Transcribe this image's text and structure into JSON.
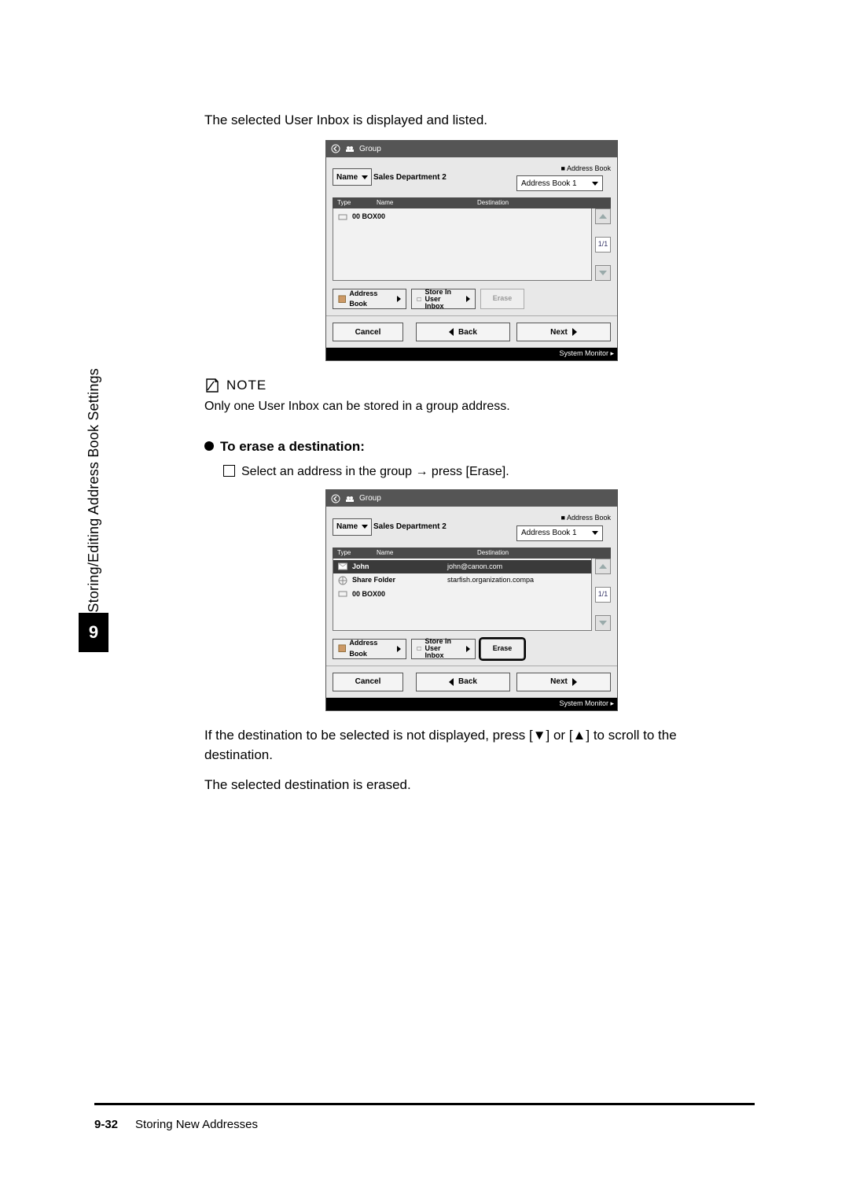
{
  "sidebar": {
    "chapter_title": "Storing/Editing Address Book Settings",
    "chapter_number": "9"
  },
  "section": {
    "intro_line": "The selected User Inbox is displayed and listed.",
    "note_label": "NOTE",
    "note_body": "Only one User Inbox can be stored in a group address.",
    "bullet_heading": "To erase a destination:",
    "step_prefix": "Select an address in the group ",
    "step_suffix": " press [Erase].",
    "after_shot_1a": "If the destination to be selected is not displayed, press [",
    "after_shot_1b": "] or [",
    "after_shot_1c": "] to scroll to the destination.",
    "after_shot_2": "The selected destination is erased."
  },
  "shot_a": {
    "title": "Group",
    "name_button": "Name",
    "name_value": "Sales Department 2",
    "addr_label": "■ Address Book",
    "addr_value": "Address Book 1",
    "col_type": "Type",
    "col_name": "Name",
    "col_dest": "Destination",
    "rows": [
      {
        "name": "00 BOX00",
        "dest": ""
      }
    ],
    "page": "1/1",
    "toolbar": {
      "address_book": "Address Book",
      "store_in": "Store In User Inbox",
      "erase": "Erase"
    },
    "nav": {
      "cancel": "Cancel",
      "back": "Back",
      "next": "Next"
    },
    "status": "System Monitor"
  },
  "shot_b": {
    "title": "Group",
    "name_button": "Name",
    "name_value": "Sales Department 2",
    "addr_label": "■ Address Book",
    "addr_value": "Address Book 1",
    "col_type": "Type",
    "col_name": "Name",
    "col_dest": "Destination",
    "rows": [
      {
        "name": "John",
        "dest": "john@canon.com",
        "selected": true,
        "icon": "mail"
      },
      {
        "name": "Share Folder",
        "dest": "starfish.organization.compa",
        "icon": "globe"
      },
      {
        "name": "00 BOX00",
        "dest": "",
        "icon": "box"
      }
    ],
    "page": "1/1",
    "toolbar": {
      "address_book": "Address Book",
      "store_in": "Store In User Inbox",
      "erase": "Erase"
    },
    "nav": {
      "cancel": "Cancel",
      "back": "Back",
      "next": "Next"
    },
    "status": "System Monitor"
  },
  "footer": {
    "page_number": "9-32",
    "section_title": "Storing New Addresses"
  }
}
